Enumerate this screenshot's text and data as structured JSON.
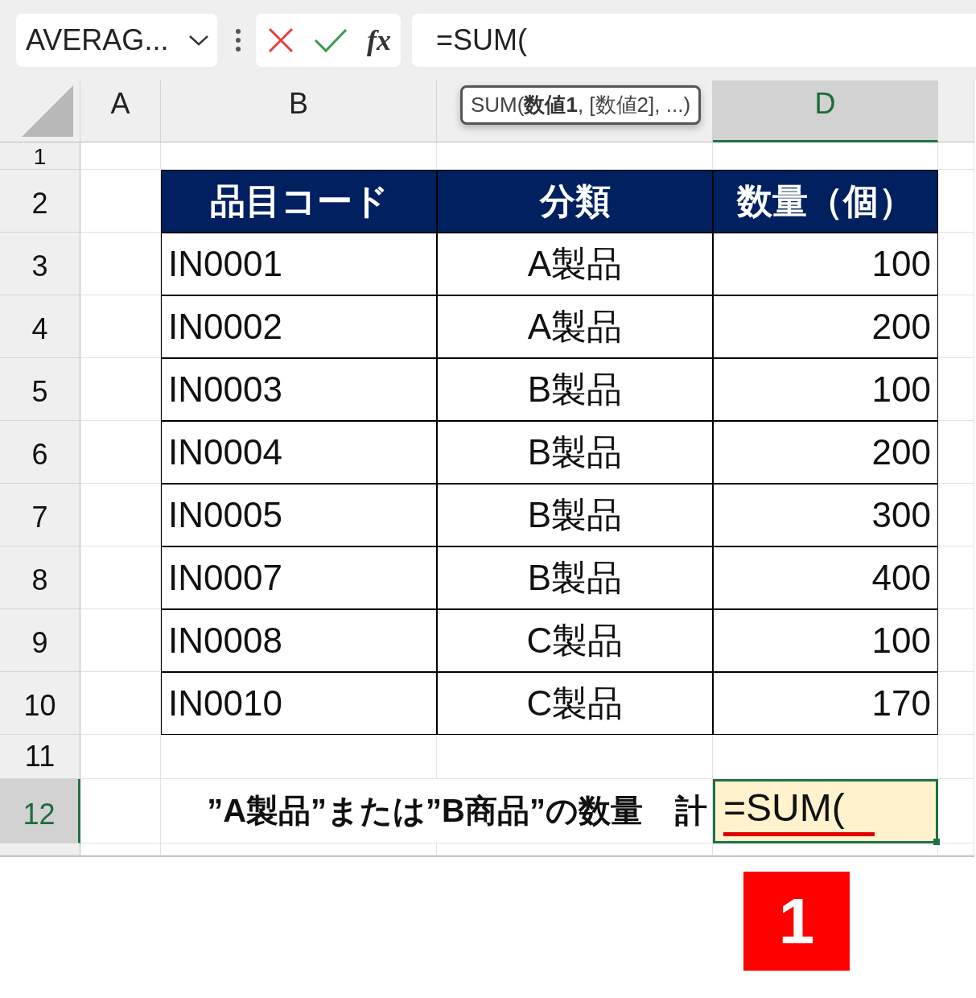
{
  "name_box": {
    "value": "AVERAG..."
  },
  "formula_bar": {
    "function_label": "fx",
    "formula": "=SUM("
  },
  "tooltip": "SUM(**数値1**, [数値2], ...)",
  "column_headers": [
    {
      "label": "A",
      "selected": false
    },
    {
      "label": "B",
      "selected": false
    },
    {
      "selected": false
    },
    {
      "label": "D",
      "selected": true
    },
    {
      "selected": false
    }
  ],
  "row_headers": [
    {
      "label": "1",
      "selected": false
    },
    {
      "label": "2",
      "selected": false
    },
    {
      "label": "3",
      "selected": false
    },
    {
      "label": "4",
      "selected": false
    },
    {
      "label": "5",
      "selected": false
    },
    {
      "label": "6",
      "selected": false
    },
    {
      "label": "7",
      "selected": false
    },
    {
      "label": "8",
      "selected": false
    },
    {
      "label": "9",
      "selected": false
    },
    {
      "label": "10",
      "selected": false
    },
    {
      "label": "11",
      "selected": false
    },
    {
      "label": "12",
      "selected": true
    },
    {
      "selected": false
    }
  ],
  "table": {
    "columns": [
      "品目コード",
      "分類",
      "数量（個）"
    ],
    "rows": [
      [
        "IN0001",
        "A製品",
        "100"
      ],
      [
        "IN0002",
        "A製品",
        "200"
      ],
      [
        "IN0003",
        "B製品",
        "100"
      ],
      [
        "IN0004",
        "B製品",
        "200"
      ],
      [
        "IN0005",
        "B製品",
        "300"
      ],
      [
        "IN0007",
        "B製品",
        "400"
      ],
      [
        "IN0008",
        "C製品",
        "100"
      ],
      [
        "IN0010",
        "C製品",
        "170"
      ]
    ]
  },
  "total_row": {
    "label": "”A製品”または”B商品”の数量　計",
    "value": "=SUM("
  },
  "step_badge": "1"
}
